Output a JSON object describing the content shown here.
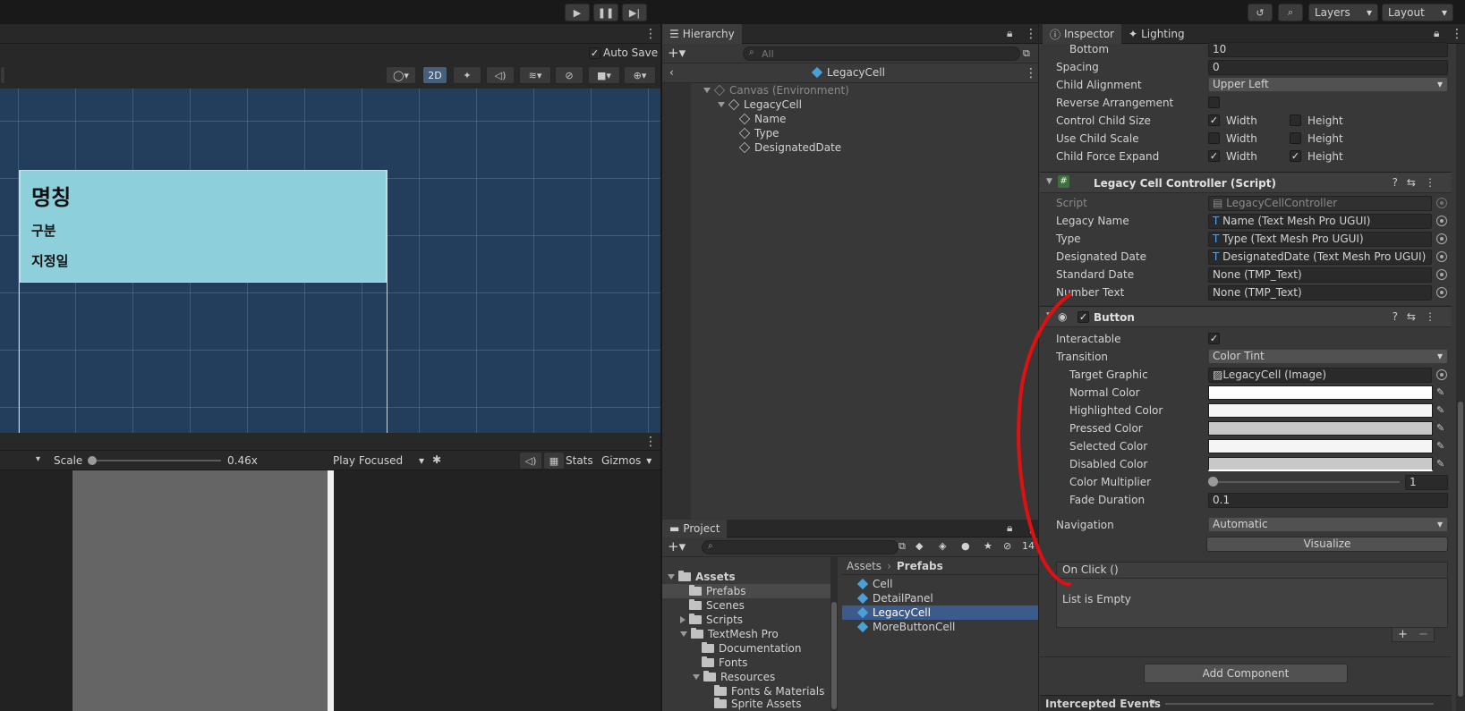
{
  "toolbar": {
    "layers": "Layers",
    "layout": "Layout"
  },
  "scene": {
    "auto_save": "Auto Save",
    "mode_2d": "2D",
    "cell_title": "명칭",
    "cell_type": "구분",
    "cell_date": "지정일"
  },
  "game": {
    "scale_label": "Scale",
    "scale_value": "0.46x",
    "play_mode": "Play Focused",
    "stats": "Stats",
    "gizmos": "Gizmos"
  },
  "hierarchy": {
    "tab": "Hierarchy",
    "search_placeholder": "All",
    "prefab_title": "LegacyCell",
    "items": [
      "Canvas (Environment)",
      "LegacyCell",
      "Name",
      "Type",
      "DesignatedDate"
    ]
  },
  "project": {
    "tab": "Project",
    "count": "14",
    "tree": [
      "Assets",
      "Prefabs",
      "Scenes",
      "Scripts",
      "TextMesh Pro",
      "Documentation",
      "Fonts",
      "Resources",
      "Fonts & Materials",
      "Sprite Assets"
    ],
    "breadcrumb": [
      "Assets",
      "Prefabs"
    ],
    "files": [
      "Cell",
      "DetailPanel",
      "LegacyCell",
      "MoreButtonCell"
    ]
  },
  "inspector": {
    "tab_inspector": "Inspector",
    "tab_lighting": "Lighting",
    "layout_group": {
      "bottom_label": "Bottom",
      "bottom_value": "10",
      "spacing_label": "Spacing",
      "spacing_value": "0",
      "child_alignment_label": "Child Alignment",
      "child_alignment_value": "Upper Left",
      "reverse_label": "Reverse Arrangement",
      "control_label": "Control Child Size",
      "scale_label": "Use Child Scale",
      "expand_label": "Child Force Expand",
      "width": "Width",
      "height": "Height"
    },
    "controller": {
      "title": "Legacy Cell Controller (Script)",
      "script_label": "Script",
      "script_value": "LegacyCellController",
      "legacy_name_label": "Legacy Name",
      "legacy_name_value": "Name (Text Mesh Pro UGUI)",
      "type_label": "Type",
      "type_value": "Type (Text Mesh Pro UGUI)",
      "designated_label": "Designated Date",
      "designated_value": "DesignatedDate (Text Mesh Pro UGUI)",
      "standard_label": "Standard Date",
      "standard_value": "None (TMP_Text)",
      "number_label": "Number Text",
      "number_value": "None (TMP_Text)"
    },
    "button": {
      "title": "Button",
      "interactable_label": "Interactable",
      "transition_label": "Transition",
      "transition_value": "Color Tint",
      "target_label": "Target Graphic",
      "target_value": "LegacyCell (Image)",
      "normal_label": "Normal Color",
      "highlighted_label": "Highlighted Color",
      "pressed_label": "Pressed Color",
      "selected_label": "Selected Color",
      "disabled_label": "Disabled Color",
      "multiplier_label": "Color Multiplier",
      "multiplier_value": "1",
      "fade_label": "Fade Duration",
      "fade_value": "0.1",
      "navigation_label": "Navigation",
      "navigation_value": "Automatic",
      "visualize": "Visualize",
      "onclick": "On Click ()",
      "list_empty": "List is Empty"
    },
    "add_component": "Add Component",
    "intercepted": "Intercepted Events"
  },
  "colors": {
    "scene_bg": "#233d5c",
    "cell_bg": "#8ecfdc",
    "selection": "#3d5a8c",
    "annotation": "#e01010"
  }
}
